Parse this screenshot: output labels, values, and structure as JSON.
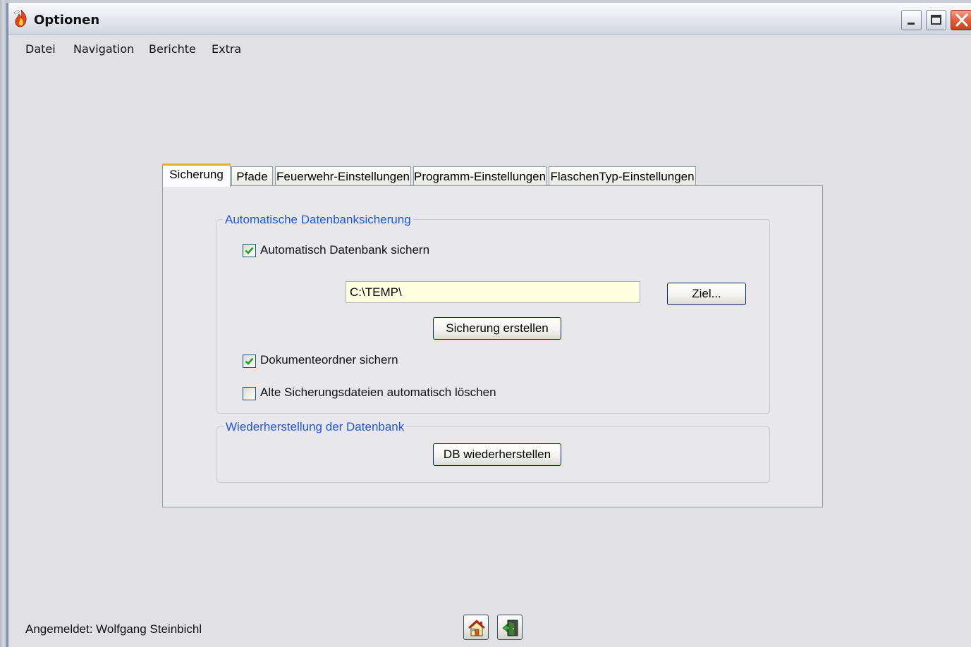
{
  "window": {
    "title": "Optionen"
  },
  "menu": {
    "items": [
      {
        "label": "Datei"
      },
      {
        "label": "Navigation"
      },
      {
        "label": "Berichte"
      },
      {
        "label": "Extra"
      }
    ]
  },
  "tabs": [
    {
      "label": "Sicherung",
      "active": true
    },
    {
      "label": "Pfade",
      "active": false
    },
    {
      "label": "Feuerwehr-Einstellungen",
      "active": false
    },
    {
      "label": "Programm-Einstellungen",
      "active": false
    },
    {
      "label": "FlaschenTyp-Einstellungen",
      "active": false
    }
  ],
  "backup_group": {
    "title": "Automatische Datenbanksicherung",
    "auto_backup": {
      "label": "Automatisch Datenbank sichern",
      "checked": true
    },
    "target_path": {
      "value": "C:\\TEMP\\"
    },
    "target_button": "Ziel...",
    "create_button": "Sicherung erstellen",
    "documents_backup": {
      "label": "Dokumenteordner sichern",
      "checked": true
    },
    "delete_old": {
      "label": "Alte Sicherungsdateien automatisch löschen",
      "checked": false
    }
  },
  "restore_group": {
    "title": "Wiederherstellung der Datenbank",
    "restore_button": "DB wiederherstellen"
  },
  "status": {
    "logged_in": "Angemeldet: Wolfgang Steinbichl"
  },
  "icons": {
    "home": "home-icon",
    "exit": "exit-door-icon",
    "app": "flame-app-icon"
  },
  "colors": {
    "group_title": "#2355d6",
    "active_tab_accent": "#f0a82e",
    "textbox_bg": "#ffffe1",
    "close_button": "#e0603f"
  }
}
